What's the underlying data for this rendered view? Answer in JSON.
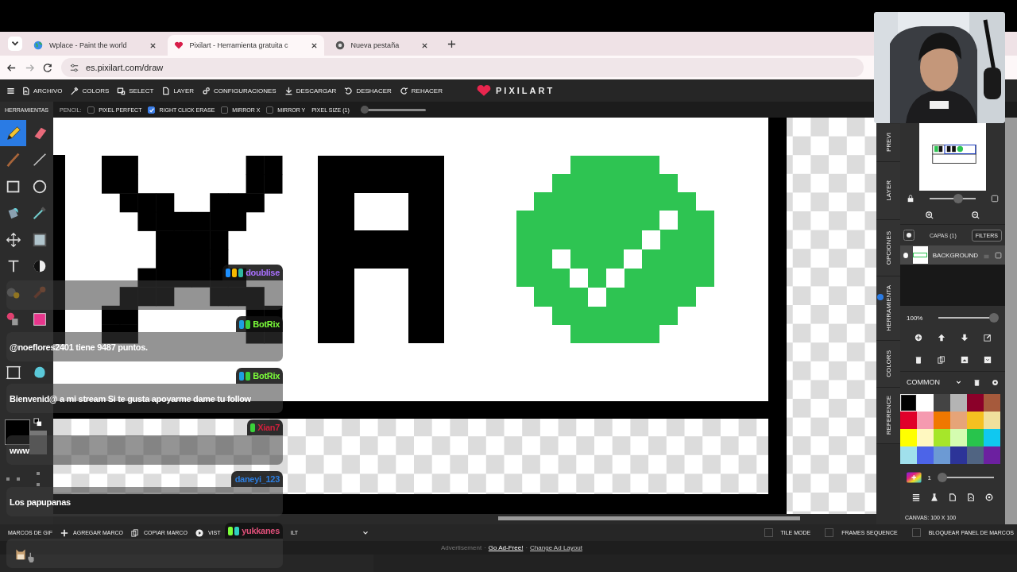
{
  "browser": {
    "tabs": [
      {
        "title": "Wplace - Paint the world",
        "selected": false
      },
      {
        "title": "Pixilart - Herramienta gratuita c",
        "selected": true
      },
      {
        "title": "Nueva pestaña",
        "selected": false
      }
    ],
    "url": "es.pixilart.com/draw"
  },
  "menu": [
    "ARCHIVO",
    "COLORS",
    "SELECT",
    "LAYER",
    "CONFIGURACIONES",
    "DESCARGAR",
    "DESHACER",
    "REHACER"
  ],
  "logo": "PIXILART",
  "tools_title": "HERRAMIENTAS",
  "tool_options": {
    "tool": "PENCIL:",
    "options": [
      {
        "label": "PIXEL PERFECT",
        "checked": false
      },
      {
        "label": "RIGHT CLICK ERASE",
        "checked": true
      },
      {
        "label": "MIRROR X",
        "checked": false
      },
      {
        "label": "MIRROR Y",
        "checked": false
      }
    ],
    "pixel_size": {
      "label": "PIXEL SIZE (1)",
      "level": 0
    }
  },
  "tools": [
    {
      "selected": true
    },
    {
      "selected": false
    },
    {
      "selected": false
    },
    {
      "selected": false
    },
    {
      "selected": false
    },
    {
      "selected": false
    },
    {
      "selected": false
    },
    {
      "selected": false
    },
    {
      "selected": false
    },
    {
      "selected": false
    },
    {
      "selected": false
    },
    {
      "selected": false
    },
    {
      "selected": false
    },
    {
      "selected": false
    },
    {
      "selected": false
    },
    {
      "selected": false
    },
    {
      "selected": false
    },
    {
      "selected": false
    }
  ],
  "side_tabs": [
    "PREVI",
    "LAYER",
    "OPCIONES",
    "HERRAMIENTA",
    "COLORS",
    "REFERENCE"
  ],
  "preview_zoom": {
    "level": 0.62
  },
  "layers": {
    "title": "CAPAS (1)",
    "filters": "FILTERS",
    "items": [
      {
        "name": "BACKGROUND",
        "visible": true
      }
    ]
  },
  "opacity": {
    "reading": "100%",
    "level": 1
  },
  "palette": {
    "name": "COMMON",
    "colors": [
      {
        "color": "#000000",
        "selected": true
      },
      {
        "color": "#ffffff",
        "selected": false
      },
      {
        "color": "#444444",
        "selected": false
      },
      {
        "color": "#b4b4b4",
        "selected": false
      },
      {
        "color": "#8b0029",
        "selected": false
      },
      {
        "color": "#a65a3c",
        "selected": false
      },
      {
        "color": "#e0002a",
        "selected": false
      },
      {
        "color": "#f59ab0",
        "selected": false
      },
      {
        "color": "#f07800",
        "selected": false
      },
      {
        "color": "#e6a478",
        "selected": false
      },
      {
        "color": "#f5c020",
        "selected": false
      },
      {
        "color": "#f0e09c",
        "selected": false
      },
      {
        "color": "#ffff00",
        "selected": false
      },
      {
        "color": "#fff8c0",
        "selected": false
      },
      {
        "color": "#a6e62a",
        "selected": false
      },
      {
        "color": "#d4fcb0",
        "selected": false
      },
      {
        "color": "#28c44c",
        "selected": false
      },
      {
        "color": "#10c8f0",
        "selected": false
      },
      {
        "color": "#a0e0ec",
        "selected": false
      },
      {
        "color": "#4c64e8",
        "selected": false
      },
      {
        "color": "#6c9ad4",
        "selected": false
      },
      {
        "color": "#2c3498",
        "selected": false
      },
      {
        "color": "#506482",
        "selected": false
      },
      {
        "color": "#6c20a0",
        "selected": false
      }
    ]
  },
  "brush_size": {
    "reading": "1",
    "level": 0
  },
  "canvas_info": "CANVAS: 100 X 100",
  "frames_bar": {
    "title": "MARCOS DE GIF",
    "actions": [
      "AGREGAR MARCO",
      "COPIAR MARCO",
      "VIST"
    ],
    "fragment": "ILT",
    "toggles": [
      {
        "label": "TILE MODE",
        "checked": false
      },
      {
        "label": "FRAMES SEQUENCE",
        "checked": false
      },
      {
        "label": "BLOQUEAR PANEL DE MARCOS",
        "checked": false
      }
    ]
  },
  "ad": [
    {
      "kind": "label",
      "text": "Advertisement"
    },
    {
      "kind": "separator",
      "text": "·"
    },
    {
      "kind": "link",
      "text": "Go Ad-Free!"
    },
    {
      "kind": "separator",
      "text": "·"
    },
    {
      "kind": "link",
      "text": "Change Ad Layout"
    }
  ],
  "chat": [
    {
      "user": "doublise",
      "color": "#a970ff",
      "badges": [
        {
          "color": "#1e90ff"
        },
        {
          "color": "#f5b800"
        },
        {
          "color": "#2fb8a0"
        }
      ]
    },
    {
      "user": "BotRix",
      "color": "#7cff3a",
      "badges": [
        {
          "color": "#1ea0e0"
        },
        {
          "color": "#3ad13a"
        }
      ],
      "text": "@noeflores2401 tiene 9487 puntos."
    },
    {
      "user": "BotRix",
      "color": "#7cff3a",
      "badges": [
        {
          "color": "#1ea0e0"
        },
        {
          "color": "#3ad13a"
        }
      ],
      "text": "Bienvenid@ a mi stream Si te gusta apoyarme dame tu follow"
    },
    {
      "user": "Xian7",
      "color": "#d0203c",
      "badges": [
        {
          "color": "#3ad13a"
        }
      ],
      "text": "www"
    },
    {
      "user": "daneyi_123",
      "color": "#2c7ee0",
      "text": "Los papupanas"
    },
    {
      "user": "yukkanes",
      "color": "#e0507a",
      "badges": [
        {
          "color": "#7cff3a"
        },
        {
          "color": "#2fd0c0"
        }
      ],
      "emote": true
    }
  ]
}
